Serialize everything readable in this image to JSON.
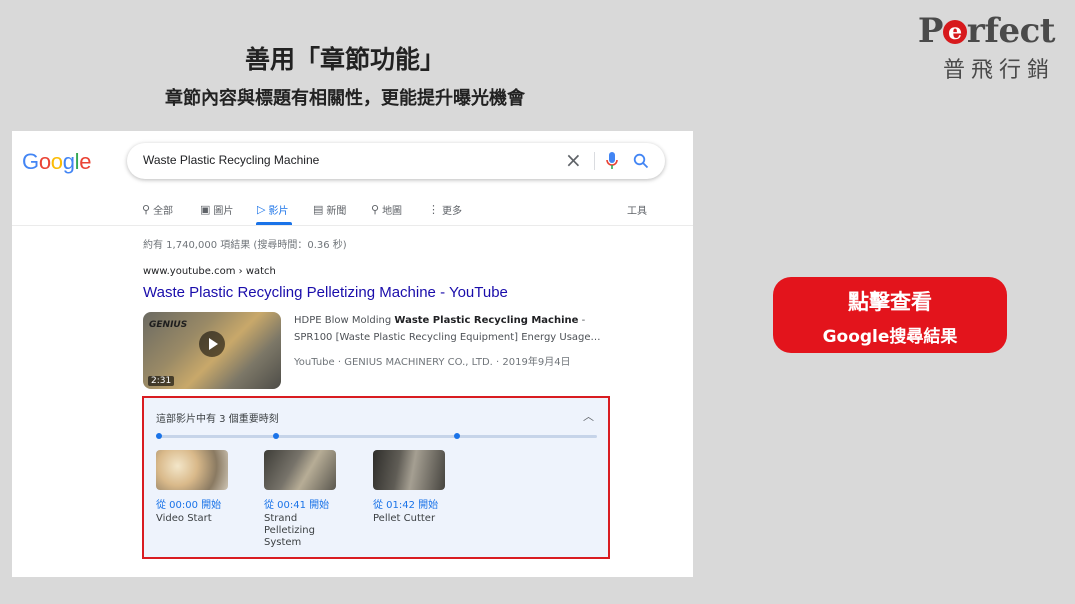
{
  "slide": {
    "title": "善用「章節功能」",
    "subtitle": "章節內容與標題有相關性，更能提升曝光機會"
  },
  "logo": {
    "text_before": "P",
    "text_e": "e",
    "text_after": "rfect",
    "chinese": "普飛行銷",
    "accent_color": "#d7191c"
  },
  "cta": {
    "line1": "點擊查看",
    "line2": "Google搜尋結果",
    "color": "#e3141c"
  },
  "google": {
    "logo_letters": [
      "G",
      "o",
      "o",
      "g",
      "l",
      "e"
    ],
    "logo_colors": [
      "#4285f4",
      "#ea4335",
      "#fbbc05",
      "#4285f4",
      "#34a853",
      "#ea4335"
    ],
    "query": "Waste Plastic Recycling Machine",
    "clear_icon": "close-icon",
    "mic_icon": "mic-icon",
    "search_icon": "search-icon"
  },
  "tabs": [
    {
      "icon": "search-icon",
      "glyph": "⚲",
      "label": "全部"
    },
    {
      "icon": "image-icon",
      "glyph": "▣",
      "label": "圖片"
    },
    {
      "icon": "video-icon",
      "glyph": "▷",
      "label": "影片"
    },
    {
      "icon": "news-icon",
      "glyph": "▤",
      "label": "新聞"
    },
    {
      "icon": "map-pin-icon",
      "glyph": "⚲",
      "label": "地圖"
    },
    {
      "icon": "more-icon",
      "glyph": "⋮",
      "label": "更多"
    }
  ],
  "tools_label": "工具",
  "result_stats": "約有 1,740,000 項結果 (搜尋時間：0.36 秒)",
  "result": {
    "cite": "www.youtube.com › watch",
    "title": "Waste Plastic Recycling Pelletizing Machine - YouTube",
    "thumb_brand": "GENIUS",
    "duration": "2:31",
    "snippet_pre": "HDPE Blow Molding ",
    "snippet_bold": "Waste Plastic Recycling Machine",
    "snippet_post": " - SPR100 [Waste Plastic Recycling Equipment] Energy Usage…",
    "meta": "YouTube · GENIUS MACHINERY CO., LTD. · 2019年9月4日"
  },
  "key_moments": {
    "title": "這部影片中有 3 個重要時刻",
    "highlight_color": "#d91c21",
    "items": [
      {
        "time": "從 00:00 開始",
        "label": "Video Start"
      },
      {
        "time": "從 00:41 開始",
        "label": "Strand Pelletizing System"
      },
      {
        "time": "從 01:42 開始",
        "label": "Pellet Cutter"
      }
    ]
  }
}
